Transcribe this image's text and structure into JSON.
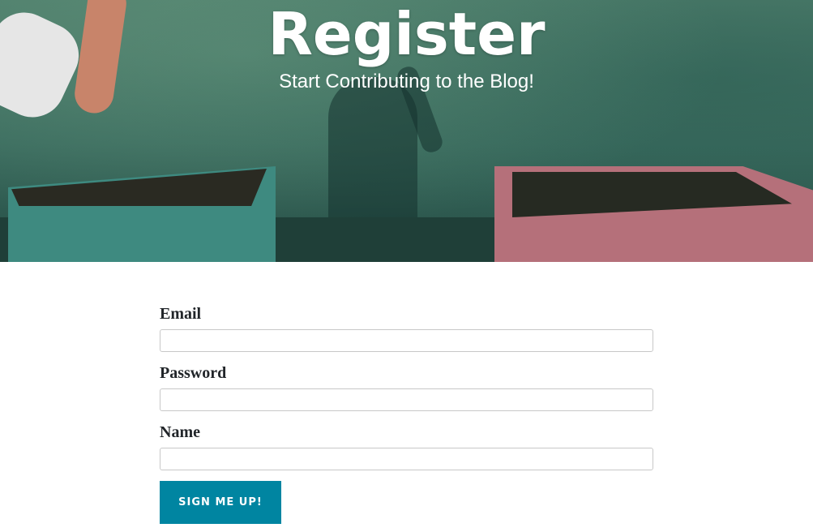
{
  "header": {
    "title": "Register",
    "subtitle": "Start Contributing to the Blog!"
  },
  "form": {
    "fields": [
      {
        "label": "Email",
        "value": "",
        "placeholder": ""
      },
      {
        "label": "Password",
        "value": "",
        "placeholder": ""
      },
      {
        "label": "Name",
        "value": "",
        "placeholder": ""
      }
    ],
    "submit_label": "Sign Me Up!"
  },
  "colors": {
    "accent": "#0085a1",
    "label_text": "#212529",
    "hero_text": "#ffffff"
  }
}
